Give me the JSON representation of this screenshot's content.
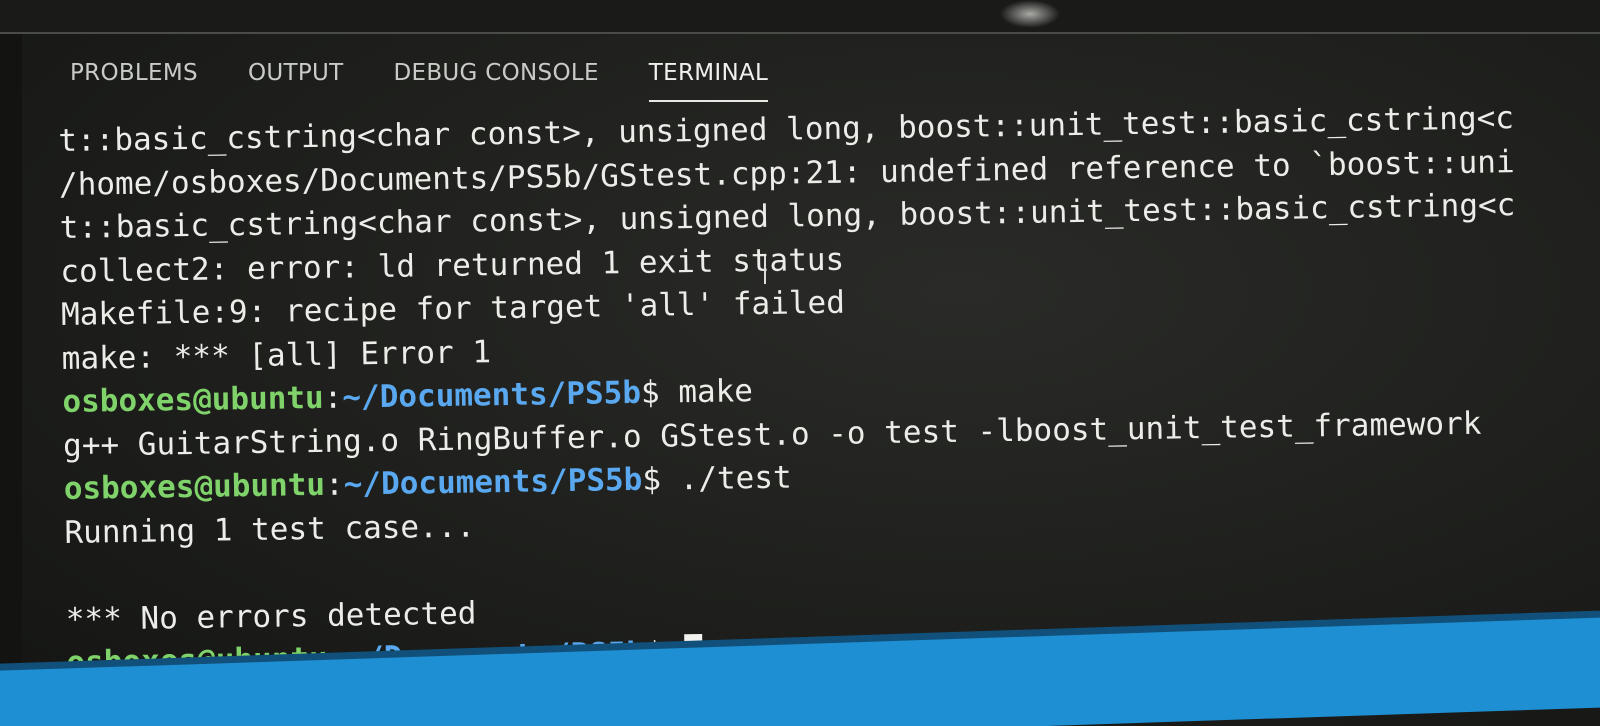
{
  "panel": {
    "tabs": [
      {
        "label": "PROBLEMS",
        "active": false
      },
      {
        "label": "OUTPUT",
        "active": false
      },
      {
        "label": "DEBUG CONSOLE",
        "active": false
      },
      {
        "label": "TERMINAL",
        "active": true
      }
    ]
  },
  "terminal": {
    "prompt_user": "osboxes@ubuntu",
    "prompt_sep": ":",
    "prompt_path": "~/Documents/PS5b",
    "prompt_dollar": "$",
    "lines": [
      {
        "type": "text",
        "text": "t::basic_cstring<char const>, unsigned long, boost::unit_test::basic_cstring<c"
      },
      {
        "type": "text",
        "text": "/home/osboxes/Documents/PS5b/GStest.cpp:21: undefined reference to `boost::uni"
      },
      {
        "type": "text",
        "text": "t::basic_cstring<char const>, unsigned long, boost::unit_test::basic_cstring<c"
      },
      {
        "type": "text",
        "text": "collect2: error: ld returned 1 exit status"
      },
      {
        "type": "text",
        "text": "Makefile:9: recipe for target 'all' failed"
      },
      {
        "type": "text",
        "text": "make: *** [all] Error 1"
      },
      {
        "type": "prompt",
        "command": " make"
      },
      {
        "type": "text",
        "text": "g++ GuitarString.o RingBuffer.o GStest.o -o test -lboost_unit_test_framework"
      },
      {
        "type": "prompt",
        "command": " ./test"
      },
      {
        "type": "text",
        "text": "Running 1 test case..."
      },
      {
        "type": "text",
        "text": ""
      },
      {
        "type": "text",
        "text": "*** No errors detected"
      },
      {
        "type": "prompt",
        "command": " "
      }
    ]
  },
  "colors": {
    "user": "#7fd36a",
    "path": "#5aa9f0",
    "text": "#ecede8",
    "status_bar": "#1f8fd3",
    "background": "#1e1f1c"
  }
}
